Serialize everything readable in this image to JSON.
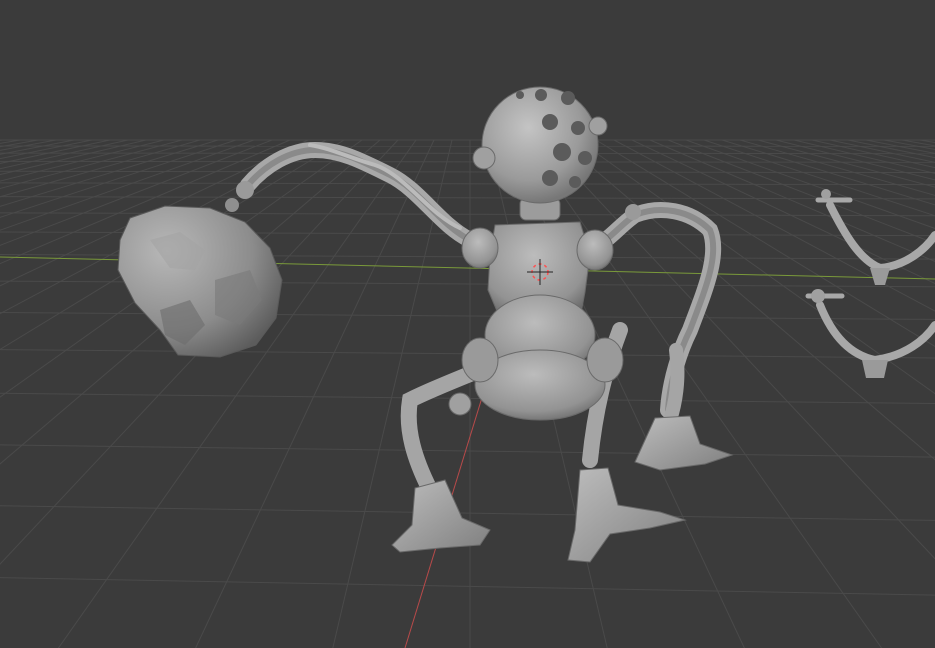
{
  "viewport": {
    "background_color": "#3b3b3b",
    "grid_color": "#4a4a4a",
    "x_axis_color": "#7a9a3a",
    "y_axis_color": "#b84a4a",
    "model_color": "#a8a8a8",
    "model_shadow_color": "#6e6e6e",
    "cursor_color": "#ff5050"
  },
  "objects": [
    {
      "id": "robot",
      "label": "",
      "icon": "robot-mesh"
    },
    {
      "id": "boulder",
      "label": "",
      "icon": "rock-mesh"
    },
    {
      "id": "bracket-upper",
      "label": "",
      "icon": "bracket-mesh"
    },
    {
      "id": "bracket-lower",
      "label": "",
      "icon": "bracket-mesh"
    }
  ],
  "cursor_3d": {
    "icon": "3d-cursor-icon"
  }
}
